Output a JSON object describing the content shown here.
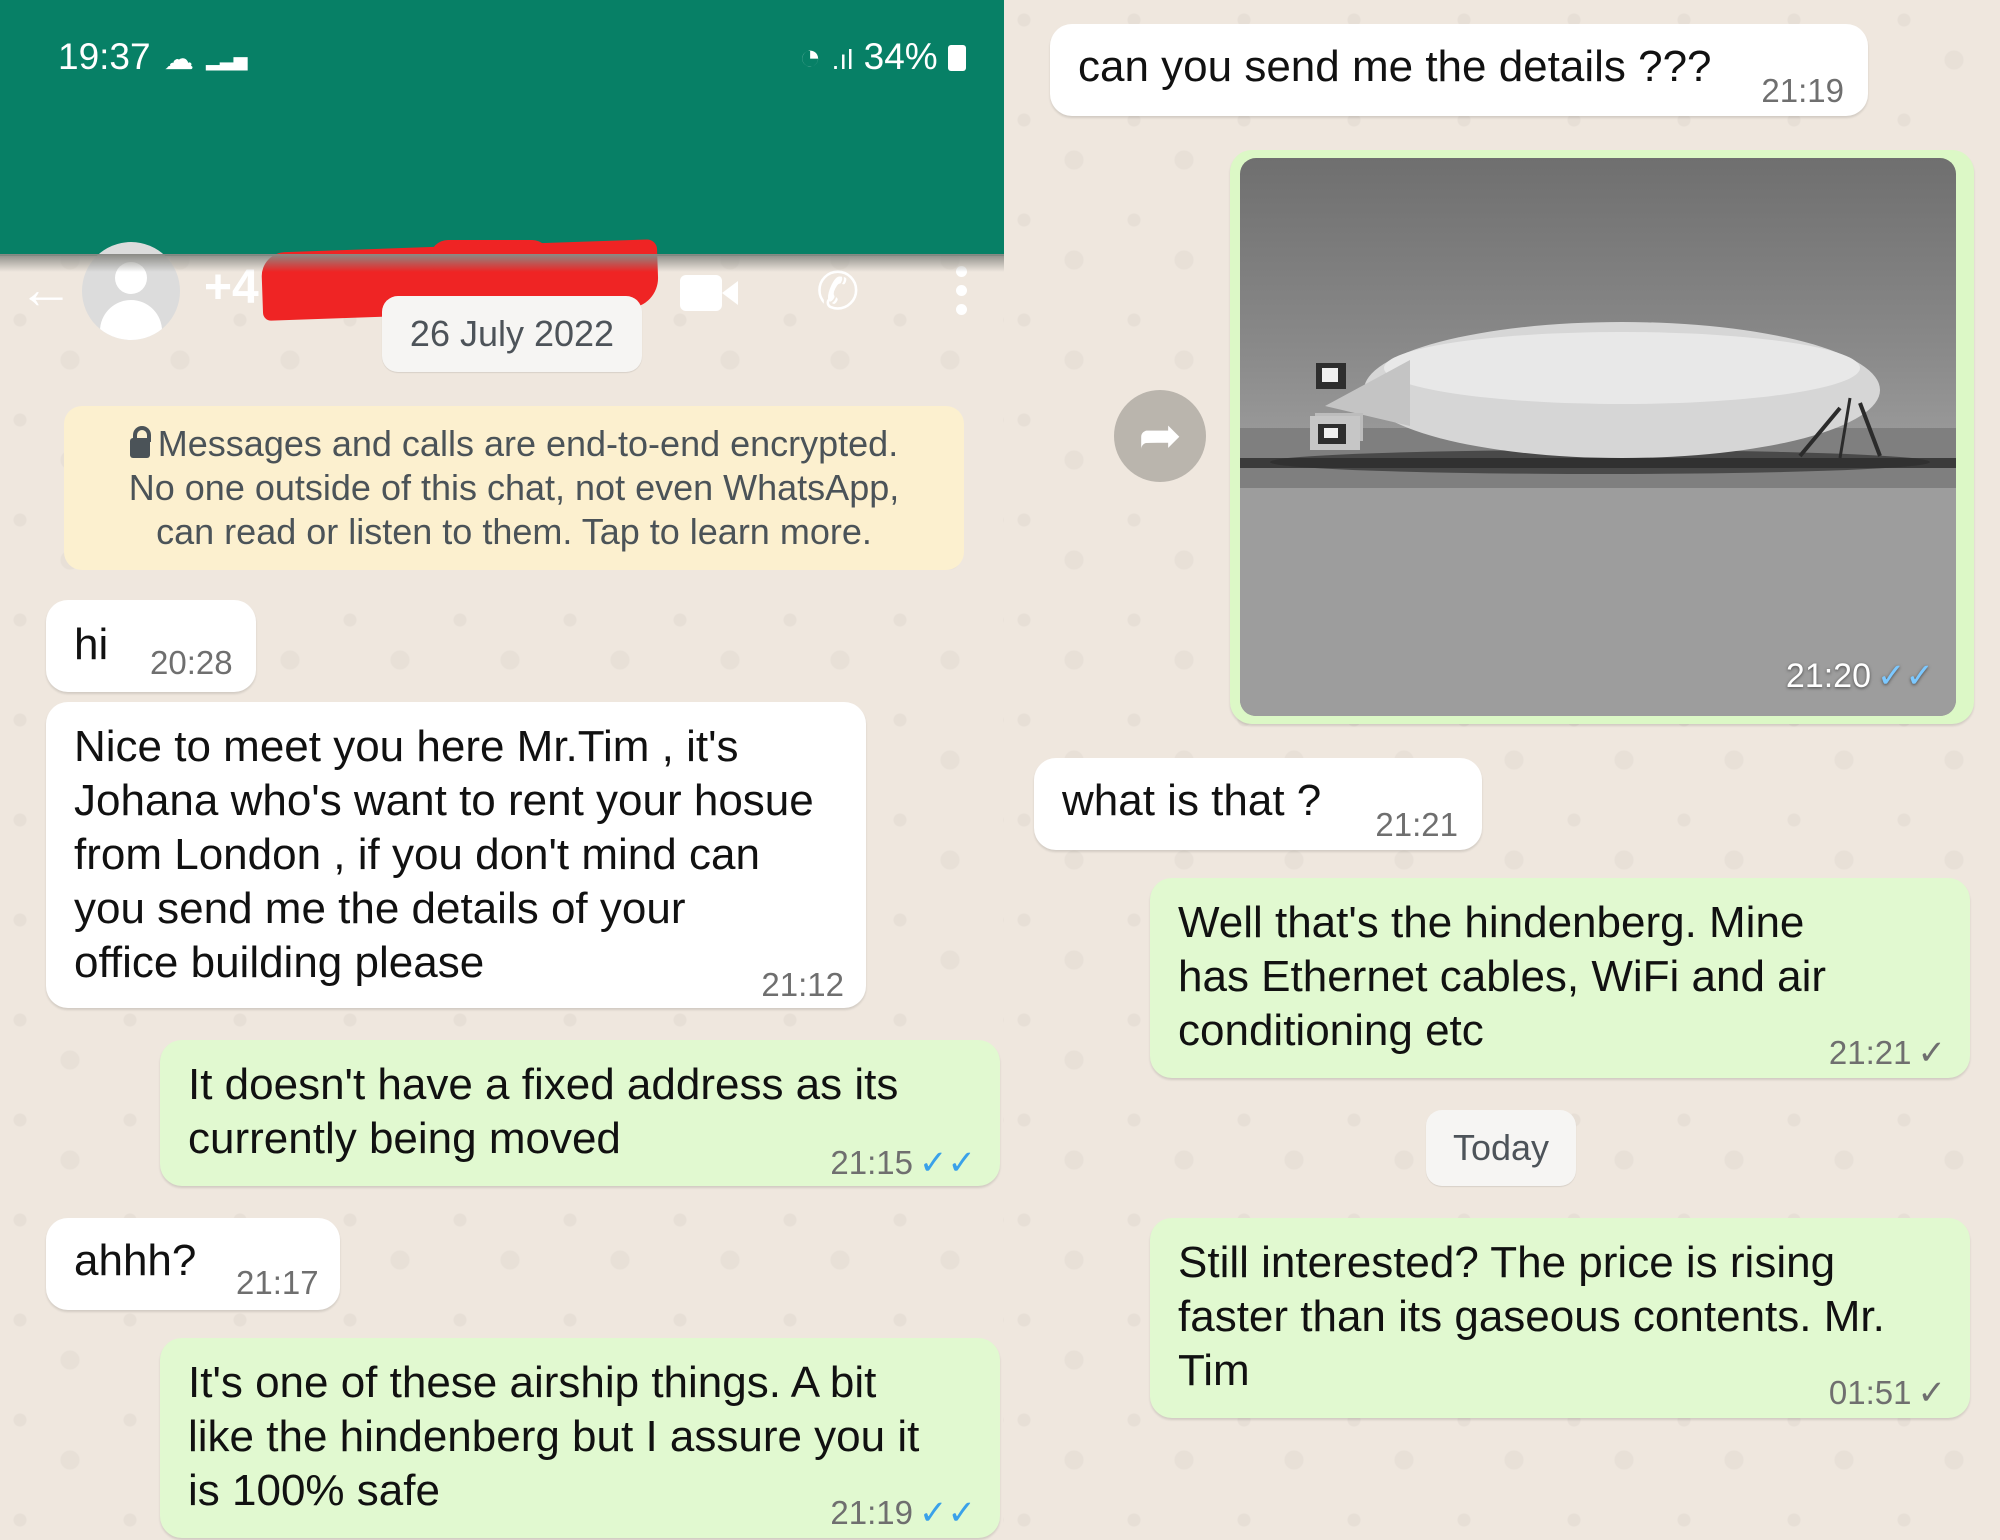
{
  "status_bar": {
    "time": "19:37",
    "cloud_icon": "cloud-icon",
    "battery": "34%",
    "wifi_icon": "wifi-icon"
  },
  "header": {
    "contact": "+4",
    "icons": [
      "back-arrow-icon",
      "avatar-icon",
      "video-call-icon",
      "phone-icon",
      "more-vert-icon"
    ],
    "color": "#078066"
  },
  "date_1": "26 July 2022",
  "encryption_notice": "Messages and calls are end-to-end encrypted.\nNo one outside of this chat, not even WhatsApp,\ncan read or listen to them. Tap to learn more.",
  "messages_left": [
    {
      "text": "hi",
      "time": "20:28"
    },
    {
      "text": "Nice to meet you here  Mr.Tim , it's\nJohana who's want to rent your hosue\nfrom London , if you don't mind can\nyou send me  the details of your\noffice building please",
      "time": "21:12"
    },
    {
      "text": "It doesn't have a fixed address as its\ncurrently being moved",
      "time": "21:15",
      "ticks": "✓✓"
    },
    {
      "text": "ahhh?",
      "time": "21:17"
    },
    {
      "text": "It's one of these airship things. A bit\nlike the hindenberg but I assure you it\nis 100% safe",
      "time": "21:19",
      "ticks": "✓✓"
    }
  ],
  "messages_right": [
    {
      "text": "can you send me the details ???",
      "time": "21:19"
    },
    {
      "image_alt": "",
      "time": "21:20",
      "ticks": "✓✓"
    },
    {
      "text": "what is that ?",
      "time": "21:21"
    },
    {
      "text": "Well that's the hindenberg. Mine\nhas Ethernet cables, WiFi and air\nconditioning etc",
      "time": "21:21",
      "ticks": "✓"
    },
    {
      "text": "Still interested? The price  is rising\nfaster than its gaseous contents. Mr.\nTim",
      "time": "01:51",
      "ticks": "✓"
    }
  ],
  "date_2": "Today",
  "colors": {
    "incoming": "#ffffff",
    "outgoing": "#e1f9d0",
    "read_ticks": "#3aa1e9",
    "notice": "#fcf0cf"
  }
}
